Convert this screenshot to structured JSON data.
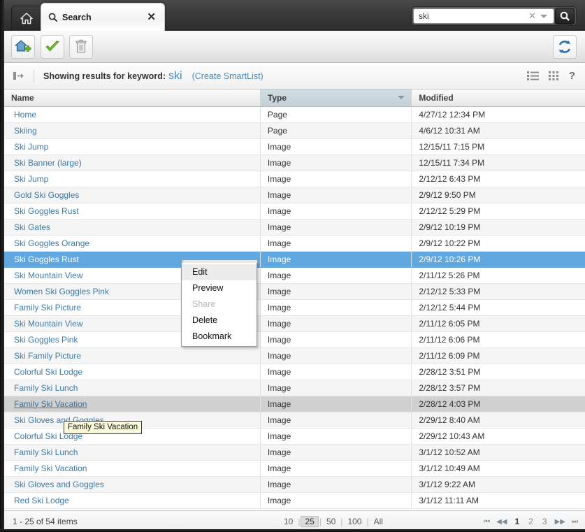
{
  "window": {
    "home_tab_icon": "home-icon",
    "search_tab": {
      "label": "Search",
      "icon": "magnifier-icon",
      "close_label": "✕"
    }
  },
  "search": {
    "value": "ski",
    "clear_label": "✕",
    "button_icon": "magnifier-icon"
  },
  "toolbar": {
    "add_page_icon": "add-page-icon",
    "approve_icon": "green-check-icon",
    "delete_icon": "trash-icon",
    "refresh_icon": "refresh-icon"
  },
  "results_bar": {
    "collapse_icon": "collapse-panel-icon",
    "label": "Showing results for keyword:",
    "keyword": "ski",
    "smartlist_link": "(Create SmartList)",
    "list_view_icon": "list-view-icon",
    "grid_view_icon": "grid-view-icon",
    "help_label": "?"
  },
  "table": {
    "columns": [
      "Name",
      "Type",
      "Modified"
    ],
    "sorted_column": "Type",
    "sort_direction": "desc",
    "rows": [
      {
        "name": "Home",
        "type": "Page",
        "modified": "4/27/12 12:34 PM"
      },
      {
        "name": "Skiing",
        "type": "Page",
        "modified": "4/6/12 10:31 AM"
      },
      {
        "name": "Ski Jump",
        "type": "Image",
        "modified": "12/15/11 7:15 PM"
      },
      {
        "name": "Ski Banner (large)",
        "type": "Image",
        "modified": "12/15/11 7:34 PM"
      },
      {
        "name": "Ski Jump",
        "type": "Image",
        "modified": "2/12/12 6:43 PM"
      },
      {
        "name": "Gold Ski Goggles",
        "type": "Image",
        "modified": "2/9/12 9:50 PM"
      },
      {
        "name": "Ski Goggles Rust",
        "type": "Image",
        "modified": "2/12/12 5:29 PM"
      },
      {
        "name": "Ski Gates",
        "type": "Image",
        "modified": "2/9/12 10:19 PM"
      },
      {
        "name": "Ski Goggles Orange",
        "type": "Image",
        "modified": "2/9/12 10:22 PM"
      },
      {
        "name": "Ski Goggles Rust",
        "type": "Image",
        "modified": "2/9/12 10:26 PM",
        "state": "selected"
      },
      {
        "name": "Ski Mountain View",
        "type": "Image",
        "modified": "2/11/12 5:26 PM"
      },
      {
        "name": "Women Ski Goggles Pink",
        "type": "Image",
        "modified": "2/12/12 5:33 PM"
      },
      {
        "name": "Family Ski Picture",
        "type": "Image",
        "modified": "2/12/12 5:44 PM"
      },
      {
        "name": "Ski Mountain View",
        "type": "Image",
        "modified": "2/11/12 6:05 PM"
      },
      {
        "name": "Ski Goggles Pink",
        "type": "Image",
        "modified": "2/11/12 6:06 PM"
      },
      {
        "name": "Ski Family Picture",
        "type": "Image",
        "modified": "2/11/12 6:09 PM"
      },
      {
        "name": "Colorful Ski Lodge",
        "type": "Image",
        "modified": "2/28/12 3:51 PM"
      },
      {
        "name": "Family Ski Lunch",
        "type": "Image",
        "modified": "2/28/12 3:57 PM"
      },
      {
        "name": "Family Ski Vacation",
        "type": "Image",
        "modified": "2/28/12 4:03 PM",
        "state": "hovered"
      },
      {
        "name": "Ski Gloves and Goggles",
        "type": "Image",
        "modified": "2/29/12 8:40 AM"
      },
      {
        "name": "Colorful Ski Lodge",
        "type": "Image",
        "modified": "2/29/12 10:43 AM"
      },
      {
        "name": "Family Ski Lunch",
        "type": "Image",
        "modified": "3/1/12 10:52 AM"
      },
      {
        "name": "Family Ski Vacation",
        "type": "Image",
        "modified": "3/1/12 10:49 AM"
      },
      {
        "name": "Ski Gloves and Goggles",
        "type": "Image",
        "modified": "3/1/12 9:22 AM"
      },
      {
        "name": "Red Ski Lodge",
        "type": "Image",
        "modified": "3/1/12 11:11 AM"
      }
    ]
  },
  "context_menu": {
    "items": [
      {
        "label": "Edit",
        "state": "active"
      },
      {
        "label": "Preview",
        "state": "normal"
      },
      {
        "label": "Share",
        "state": "disabled"
      },
      {
        "label": "Delete",
        "state": "normal"
      },
      {
        "label": "Bookmark",
        "state": "normal"
      }
    ]
  },
  "tooltip": {
    "text": "Family Ski Vacation"
  },
  "footer": {
    "count_text": "1 - 25 of 54 items",
    "page_sizes": [
      "10",
      "25",
      "50",
      "100",
      "All"
    ],
    "active_page_size": "25",
    "pages": [
      "1",
      "2",
      "3"
    ],
    "active_page": "1",
    "nav": {
      "first": "⏮",
      "prev": "◀◀",
      "next": "▶▶",
      "last": "⏭"
    }
  },
  "colors": {
    "selection": "#62a8e0",
    "link": "#3b7aa8",
    "hover_row": "#d0d0d0",
    "tooltip_bg": "#fbfbdc",
    "sorted_header": "#c3d0d8"
  }
}
